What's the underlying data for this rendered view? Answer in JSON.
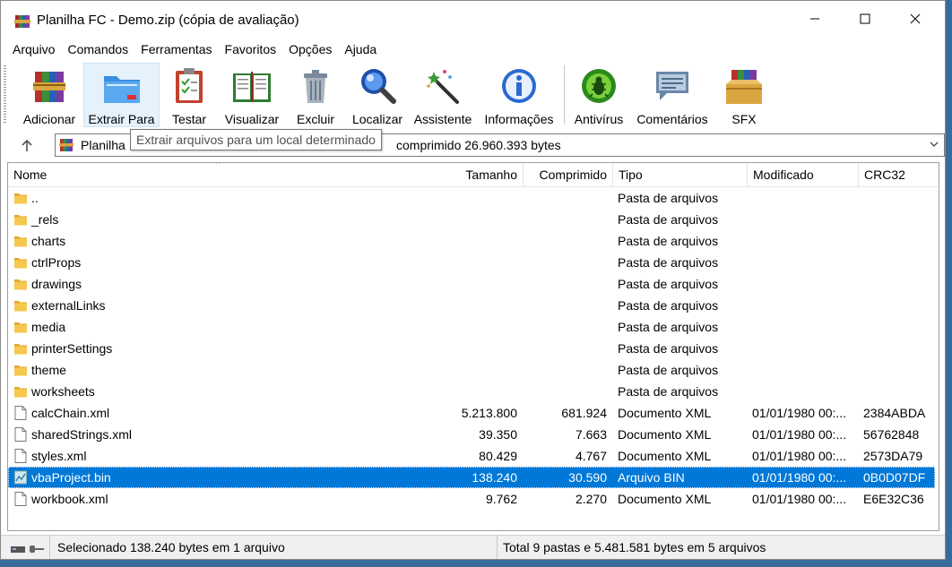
{
  "window": {
    "title": "Planilha FC - Demo.zip (cópia de avaliação)"
  },
  "menu": [
    "Arquivo",
    "Comandos",
    "Ferramentas",
    "Favoritos",
    "Opções",
    "Ajuda"
  ],
  "toolbar": [
    {
      "id": "add",
      "label": "Adicionar",
      "icon": "books-add-icon"
    },
    {
      "id": "extract",
      "label": "Extrair Para",
      "icon": "folder-extract-icon"
    },
    {
      "id": "test",
      "label": "Testar",
      "icon": "clipboard-check-icon"
    },
    {
      "id": "view",
      "label": "Visualizar",
      "icon": "book-open-icon"
    },
    {
      "id": "delete",
      "label": "Excluir",
      "icon": "trash-icon"
    },
    {
      "id": "find",
      "label": "Localizar",
      "icon": "magnifier-icon"
    },
    {
      "id": "wizard",
      "label": "Assistente",
      "icon": "magic-wand-icon"
    },
    {
      "id": "info",
      "label": "Informações",
      "icon": "info-icon"
    },
    {
      "id": "virus",
      "label": "Antivírus",
      "icon": "bug-icon"
    },
    {
      "id": "comment",
      "label": "Comentários",
      "icon": "speech-bubble-icon"
    },
    {
      "id": "sfx",
      "label": "SFX",
      "icon": "box-books-icon"
    }
  ],
  "address": {
    "text_start": "Planilha",
    "text_end": "comprimido 26.960.393 bytes"
  },
  "tooltip": "Extrair arquivos para um local determinado",
  "columns": [
    "Nome",
    "Tamanho",
    "Comprimido",
    "Tipo",
    "Modificado",
    "CRC32"
  ],
  "files": [
    {
      "name": "..",
      "size": "",
      "packed": "",
      "type": "Pasta de arquivos",
      "modified": "",
      "crc": "",
      "kind": "folder"
    },
    {
      "name": "_rels",
      "size": "",
      "packed": "",
      "type": "Pasta de arquivos",
      "modified": "",
      "crc": "",
      "kind": "folder"
    },
    {
      "name": "charts",
      "size": "",
      "packed": "",
      "type": "Pasta de arquivos",
      "modified": "",
      "crc": "",
      "kind": "folder"
    },
    {
      "name": "ctrlProps",
      "size": "",
      "packed": "",
      "type": "Pasta de arquivos",
      "modified": "",
      "crc": "",
      "kind": "folder"
    },
    {
      "name": "drawings",
      "size": "",
      "packed": "",
      "type": "Pasta de arquivos",
      "modified": "",
      "crc": "",
      "kind": "folder"
    },
    {
      "name": "externalLinks",
      "size": "",
      "packed": "",
      "type": "Pasta de arquivos",
      "modified": "",
      "crc": "",
      "kind": "folder"
    },
    {
      "name": "media",
      "size": "",
      "packed": "",
      "type": "Pasta de arquivos",
      "modified": "",
      "crc": "",
      "kind": "folder"
    },
    {
      "name": "printerSettings",
      "size": "",
      "packed": "",
      "type": "Pasta de arquivos",
      "modified": "",
      "crc": "",
      "kind": "folder"
    },
    {
      "name": "theme",
      "size": "",
      "packed": "",
      "type": "Pasta de arquivos",
      "modified": "",
      "crc": "",
      "kind": "folder"
    },
    {
      "name": "worksheets",
      "size": "",
      "packed": "",
      "type": "Pasta de arquivos",
      "modified": "",
      "crc": "",
      "kind": "folder"
    },
    {
      "name": "calcChain.xml",
      "size": "5.213.800",
      "packed": "681.924",
      "type": "Documento XML",
      "modified": "01/01/1980 00:...",
      "crc": "2384ABDA",
      "kind": "file"
    },
    {
      "name": "sharedStrings.xml",
      "size": "39.350",
      "packed": "7.663",
      "type": "Documento XML",
      "modified": "01/01/1980 00:...",
      "crc": "56762848",
      "kind": "file"
    },
    {
      "name": "styles.xml",
      "size": "80.429",
      "packed": "4.767",
      "type": "Documento XML",
      "modified": "01/01/1980 00:...",
      "crc": "2573DA79",
      "kind": "file"
    },
    {
      "name": "vbaProject.bin",
      "size": "138.240",
      "packed": "30.590",
      "type": "Arquivo BIN",
      "modified": "01/01/1980 00:...",
      "crc": "0B0D07DF",
      "kind": "bin",
      "selected": true
    },
    {
      "name": "workbook.xml",
      "size": "9.762",
      "packed": "2.270",
      "type": "Documento XML",
      "modified": "01/01/1980 00:...",
      "crc": "E6E32C36",
      "kind": "file"
    }
  ],
  "status": {
    "left": "Selecionado 138.240 bytes em 1 arquivo",
    "right": "Total 9 pastas e 5.481.581 bytes em 5 arquivos"
  },
  "colors": {
    "selection": "#0078d7",
    "folder": "#f4c04a"
  }
}
